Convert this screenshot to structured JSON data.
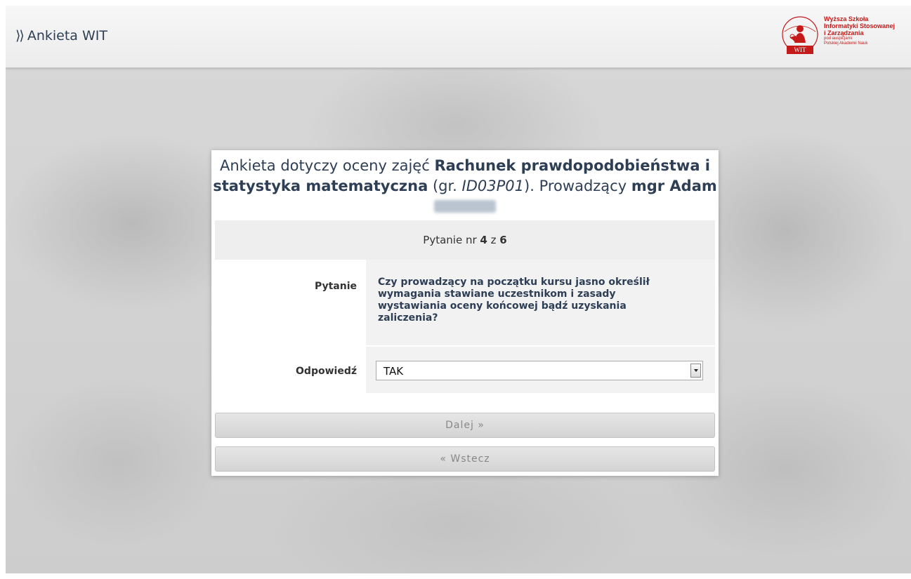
{
  "topbar": {
    "brand_arrows": "⟩⟩",
    "brand_title": "Ankieta WIT",
    "logo": {
      "name": "wit-logo",
      "line1": "Wyższa Szkoła",
      "line2": "Informatyki Stosowanej",
      "line3": "i Zarządzania",
      "line4": "pod auspicjami",
      "line5": "Polskiej Akademii Nauk",
      "emblem_text": "WIT",
      "color": "#c41a1a"
    }
  },
  "survey": {
    "intro": "Ankieta dotyczy oceny zajęć",
    "course": "Rachunek prawdopodobieństwa i statystyka matematyczna",
    "group_prefix": "(gr.",
    "group_code": "ID03P01",
    "group_suffix": ").",
    "lecturer_prefix": "Prowadzący",
    "lecturer_name": "mgr Adam"
  },
  "progress": {
    "label": "Pytanie nr",
    "current": "4",
    "separator": "z",
    "total": "6"
  },
  "question": {
    "label": "Pytanie",
    "text": "Czy prowadzący na początku kursu jasno określił wymagania stawiane uczestnikom i zasady wystawiania oceny końcowej bądź uzyskania zaliczenia?"
  },
  "answer": {
    "label": "Odpowiedź",
    "selected": "TAK"
  },
  "buttons": {
    "next": "Dalej »",
    "back": "« Wstecz"
  },
  "colors": {
    "text_primary": "#2d3e55",
    "panel_bg": "#eeeeee",
    "button_text": "#888888"
  }
}
